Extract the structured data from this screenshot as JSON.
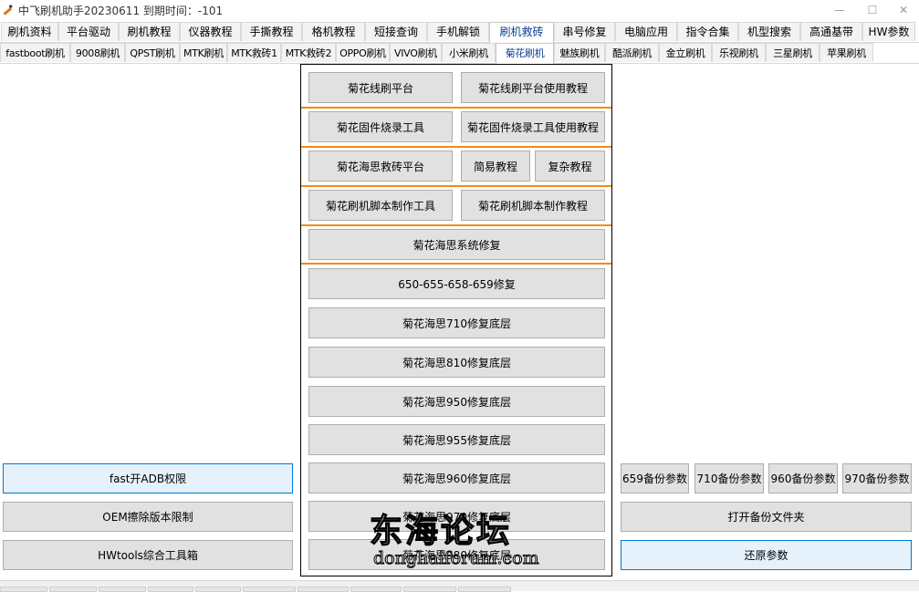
{
  "window": {
    "title": "中飞刷机助手20230611  到期时间：-101",
    "min_glyph": "—",
    "max_glyph": "☐",
    "close_glyph": "✕",
    "accent_color": "#f08c1c",
    "focus_color": "#0078d7"
  },
  "tabs_main": [
    {
      "label": "刷机资料"
    },
    {
      "label": "平台驱动"
    },
    {
      "label": "刷机教程"
    },
    {
      "label": "仪器教程"
    },
    {
      "label": "手撕教程"
    },
    {
      "label": "格机教程"
    },
    {
      "label": "短接查询"
    },
    {
      "label": "手机解锁"
    },
    {
      "label": "刷机救砖",
      "active": true
    },
    {
      "label": "串号修复"
    },
    {
      "label": "电脑应用"
    },
    {
      "label": "指令合集"
    },
    {
      "label": "机型搜索"
    },
    {
      "label": "高通基带"
    },
    {
      "label": "HW参数"
    }
  ],
  "tabs_sub": [
    {
      "label": "fastboot刷机"
    },
    {
      "label": "9008刷机"
    },
    {
      "label": "QPST刷机"
    },
    {
      "label": "MTK刷机"
    },
    {
      "label": "MTK救砖1"
    },
    {
      "label": "MTK救砖2"
    },
    {
      "label": "OPPO刷机"
    },
    {
      "label": "VIVO刷机"
    },
    {
      "label": "小米刷机"
    },
    {
      "label": "菊花刷机",
      "active": true
    },
    {
      "label": "魅族刷机"
    },
    {
      "label": "酷派刷机"
    },
    {
      "label": "金立刷机"
    },
    {
      "label": "乐视刷机"
    },
    {
      "label": "三星刷机"
    },
    {
      "label": "苹果刷机"
    }
  ],
  "center": {
    "flash_platform": "菊花线刷平台",
    "flash_platform_tutorial": "菊花线刷平台使用教程",
    "firmware_tool": "菊花固件烧录工具",
    "firmware_tool_tutorial": "菊花固件烧录工具使用教程",
    "hisilicon_unbrick": "菊花海思救砖平台",
    "simple_tutorial": "简易教程",
    "complex_tutorial": "复杂教程",
    "script_tool": "菊花刷机脚本制作工具",
    "script_tutorial": "菊花刷机脚本制作教程",
    "system_repair": "菊花海思系统修复",
    "repair_650": "650-655-658-659修复",
    "repair_710": "菊花海思710修复底层",
    "repair_810": "菊花海思810修复底层",
    "repair_950": "菊花海思950修复底层",
    "repair_955": "菊花海思955修复底层",
    "repair_960": "菊花海思960修复底层",
    "repair_970": "菊花海思970修复底层",
    "repair_980": "菊花海思980修复底层"
  },
  "left": {
    "fast_adb": "fast开ADB权限",
    "oem_erase": "OEM擦除版本限制",
    "hwtools": "HWtools综合工具箱"
  },
  "right": {
    "backup_659": "659备份参数",
    "backup_710": "710备份参数",
    "backup_960": "960备份参数",
    "backup_970": "970备份参数",
    "open_folder": "打开备份文件夹",
    "restore": "还原参数"
  },
  "watermark": {
    "title": "东海论坛",
    "url": "donghaiforum.com"
  }
}
